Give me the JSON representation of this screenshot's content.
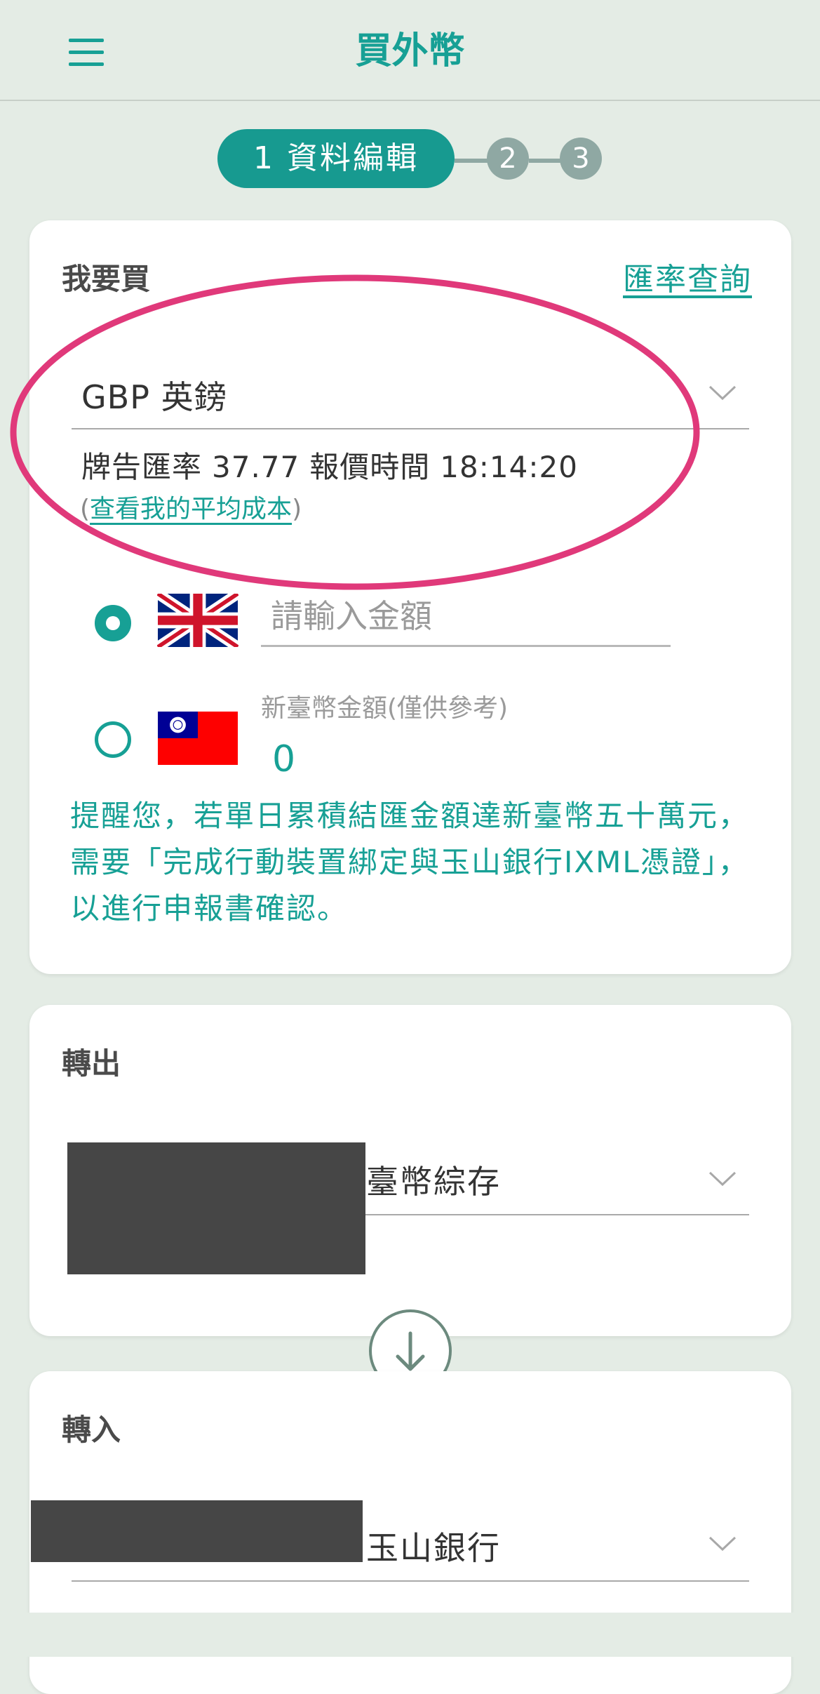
{
  "header": {
    "title": "買外幣",
    "menu_icon": "hamburger-menu-icon"
  },
  "stepper": {
    "steps": [
      {
        "label": "1 資料編輯",
        "state": "active"
      },
      {
        "label": "2",
        "state": "inactive"
      },
      {
        "label": "3",
        "state": "inactive"
      }
    ]
  },
  "buy_card": {
    "section_label": "我要買",
    "rate_query_link": "匯率查詢",
    "currency_value": "GBP 英鎊",
    "rate_label": "牌告匯率",
    "rate_value": "37.77",
    "quote_time_label": "報價時間",
    "quote_time_value": "18:14:20",
    "avg_cost_open": "(",
    "avg_cost_link": "查看我的平均成本",
    "avg_cost_close": ")",
    "foreign_amount_placeholder": "請輸入金額",
    "foreign_amount_value": "",
    "twd_amount_label": "新臺幣金額(僅供參考)",
    "twd_amount_value": "0",
    "reminder": "提醒您，若單日累積結匯金額達新臺幣五十萬元，需要「完成行動裝置綁定與玉山銀行IXML憑證」，以進行申報書確認。"
  },
  "transfer_out": {
    "section_label": "轉出",
    "account_name": "臺幣綜存"
  },
  "transfer_in": {
    "section_label": "轉入",
    "account_name": "玉山銀行"
  },
  "colors": {
    "brand": "#17a095",
    "background": "#e4ece5",
    "highlight": "#e0397a",
    "redaction": "#464646",
    "uk_flag_red": "#cf142b",
    "uk_flag_blue": "#00247d",
    "tw_flag_red": "#fe0000",
    "tw_flag_blue": "#000095"
  }
}
